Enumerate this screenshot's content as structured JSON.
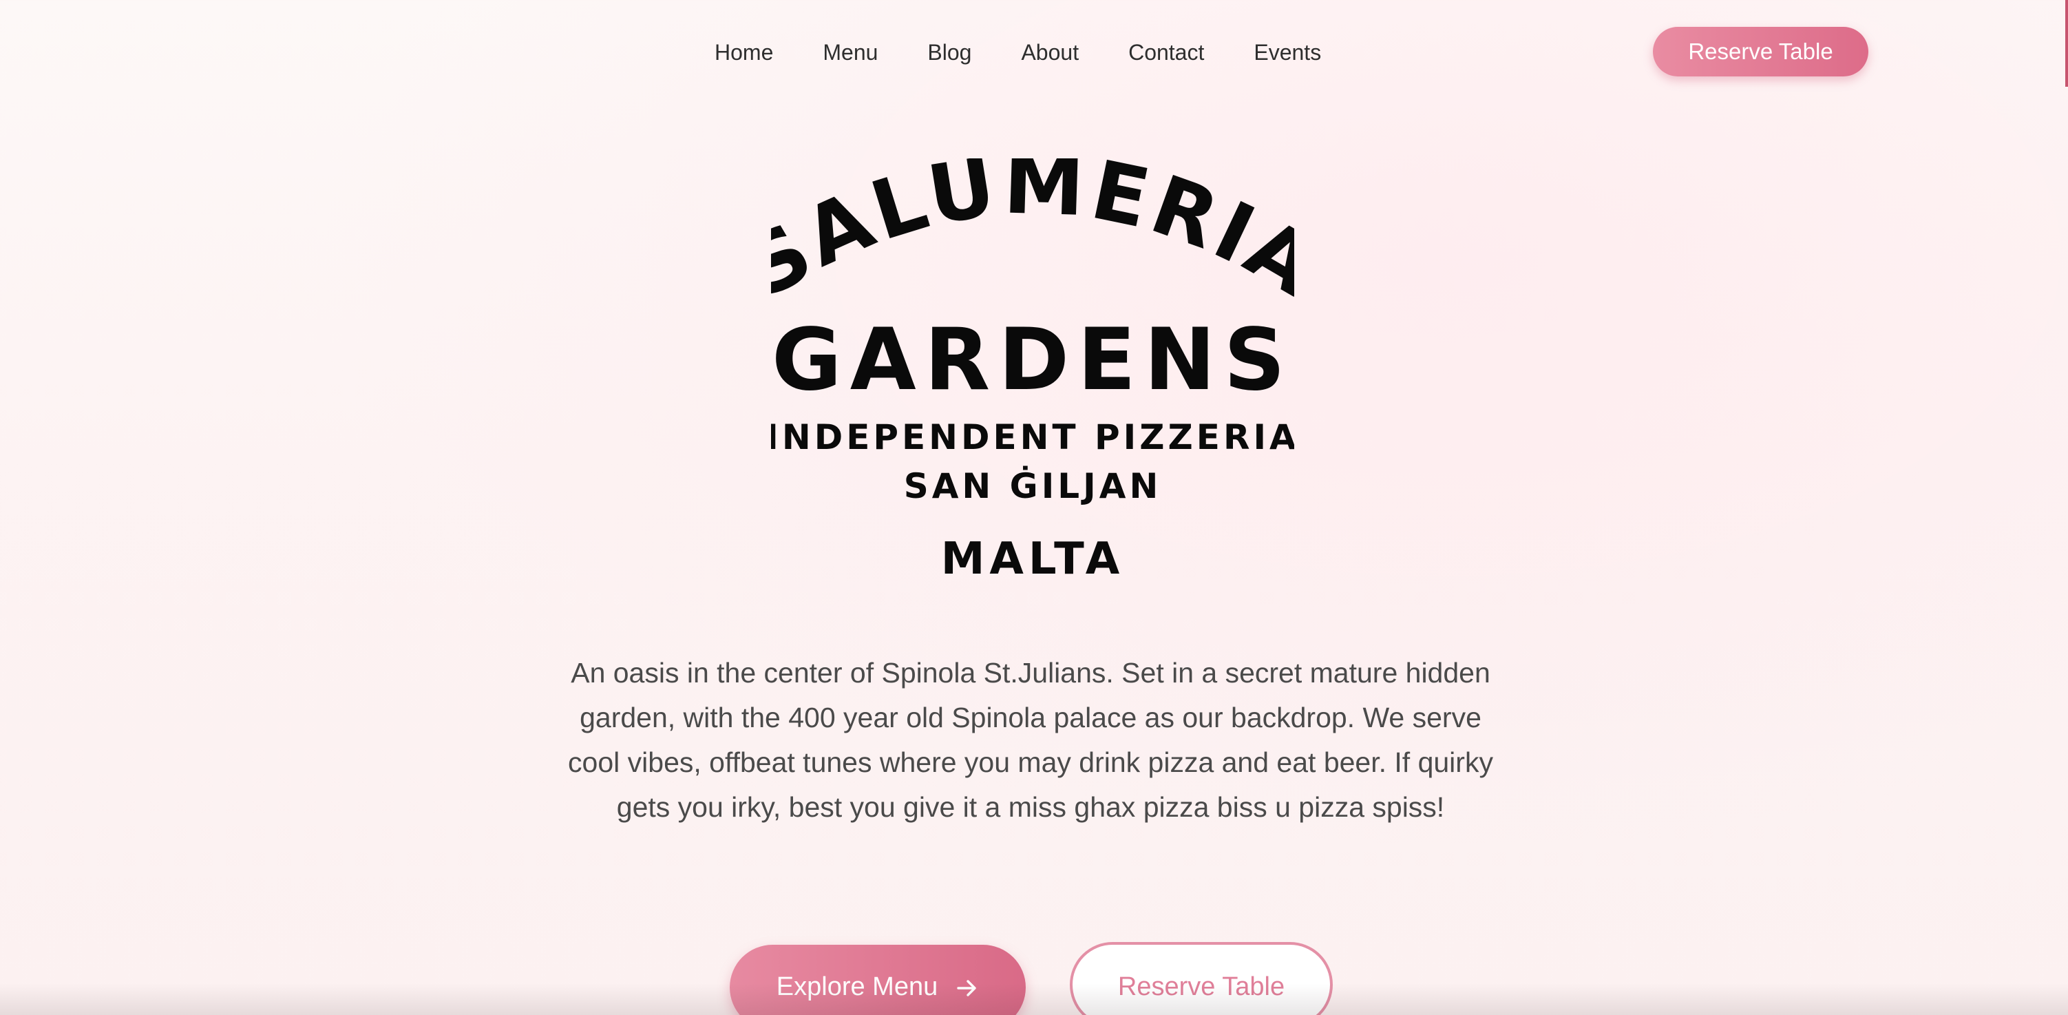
{
  "nav": {
    "items": [
      {
        "label": "Home"
      },
      {
        "label": "Menu"
      },
      {
        "label": "Blog"
      },
      {
        "label": "About"
      },
      {
        "label": "Contact"
      },
      {
        "label": "Events"
      }
    ],
    "reserve_label": "Reserve Table"
  },
  "logo": {
    "line1": "SALUMERIA",
    "line2": "GARDENS",
    "line3": "INDEPENDENT PIZZERIA",
    "line4": "SAN ĠILJAN",
    "line5": "MALTA"
  },
  "hero": {
    "description": "An oasis in the center of Spinola St.Julians. Set in a secret mature hidden garden, with the 400 year old Spinola palace as our backdrop. We serve cool vibes, offbeat tunes where you may drink pizza and eat beer. If quirky gets you irky, best you give it a miss ghax pizza biss u pizza spiss!",
    "explore_label": "Explore Menu",
    "reserve_label": "Reserve Table"
  },
  "colors": {
    "accent": "#dd6c89",
    "accent_light": "#e98ca2",
    "outline": "#e490a6",
    "text": "#4a4a4a",
    "background": "#fdf5f4"
  },
  "icons": {
    "explore_arrow": "arrow-right-icon"
  }
}
